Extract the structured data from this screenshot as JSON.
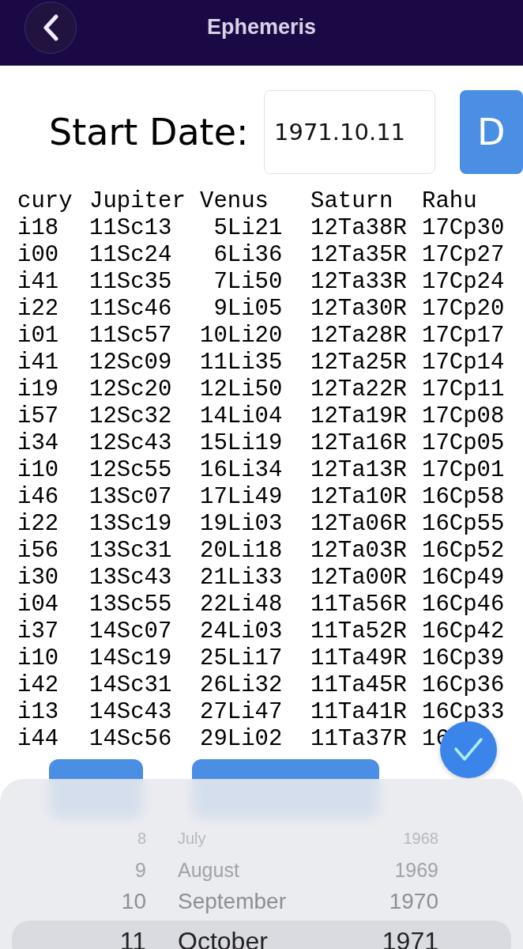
{
  "header": {
    "title": "Ephemeris"
  },
  "start_date": {
    "label": "Start Date:",
    "value": "1971.10.11",
    "button_label": "D"
  },
  "table": {
    "columns": [
      "cury",
      "Jupiter",
      "Venus",
      "Saturn",
      "Rahu"
    ],
    "rows": [
      [
        "i18",
        "11Sc13",
        "5Li21",
        "12Ta38R",
        "17Cp30"
      ],
      [
        "i00",
        "11Sc24",
        "6Li36",
        "12Ta35R",
        "17Cp27"
      ],
      [
        "i41",
        "11Sc35",
        "7Li50",
        "12Ta33R",
        "17Cp24"
      ],
      [
        "i22",
        "11Sc46",
        "9Li05",
        "12Ta30R",
        "17Cp20"
      ],
      [
        "i01",
        "11Sc57",
        "10Li20",
        "12Ta28R",
        "17Cp17"
      ],
      [
        "i41",
        "12Sc09",
        "11Li35",
        "12Ta25R",
        "17Cp14"
      ],
      [
        "i19",
        "12Sc20",
        "12Li50",
        "12Ta22R",
        "17Cp11"
      ],
      [
        "i57",
        "12Sc32",
        "14Li04",
        "12Ta19R",
        "17Cp08"
      ],
      [
        "i34",
        "12Sc43",
        "15Li19",
        "12Ta16R",
        "17Cp05"
      ],
      [
        "i10",
        "12Sc55",
        "16Li34",
        "12Ta13R",
        "17Cp01"
      ],
      [
        "i46",
        "13Sc07",
        "17Li49",
        "12Ta10R",
        "16Cp58"
      ],
      [
        "i22",
        "13Sc19",
        "19Li03",
        "12Ta06R",
        "16Cp55"
      ],
      [
        "i56",
        "13Sc31",
        "20Li18",
        "12Ta03R",
        "16Cp52"
      ],
      [
        "i30",
        "13Sc43",
        "21Li33",
        "12Ta00R",
        "16Cp49"
      ],
      [
        "i04",
        "13Sc55",
        "22Li48",
        "11Ta56R",
        "16Cp46"
      ],
      [
        "i37",
        "14Sc07",
        "24Li03",
        "11Ta52R",
        "16Cp42"
      ],
      [
        "i10",
        "14Sc19",
        "25Li17",
        "11Ta49R",
        "16Cp39"
      ],
      [
        "i42",
        "14Sc31",
        "26Li32",
        "11Ta45R",
        "16Cp36"
      ],
      [
        "i13",
        "14Sc43",
        "27Li47",
        "11Ta41R",
        "16Cp33"
      ],
      [
        "i44",
        "14Sc56",
        "29Li02",
        "11Ta37R",
        "16"
      ]
    ]
  },
  "picker": {
    "rows": [
      {
        "day": "8",
        "month": "July",
        "year": "1968",
        "selected": false
      },
      {
        "day": "9",
        "month": "August",
        "year": "1969",
        "selected": false
      },
      {
        "day": "10",
        "month": "September",
        "year": "1970",
        "selected": false
      },
      {
        "day": "11",
        "month": "October",
        "year": "1971",
        "selected": true
      }
    ]
  }
}
